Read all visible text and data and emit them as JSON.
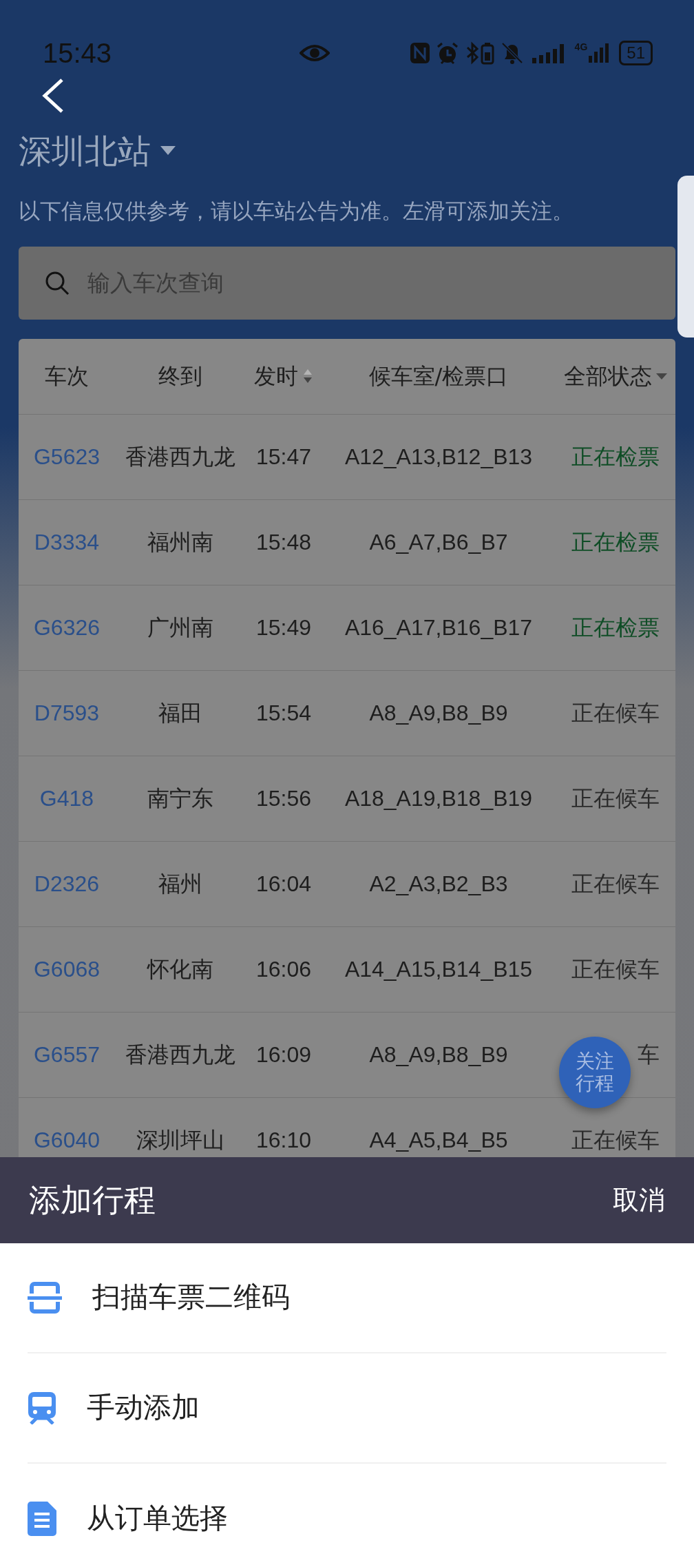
{
  "status_bar": {
    "time": "15:43",
    "network": "4G",
    "battery": "51"
  },
  "header": {
    "title": "深圳北站",
    "notice": "以下信息仅供参考，请以车站公告为准。左滑可添加关注。"
  },
  "search": {
    "placeholder": "输入车次查询"
  },
  "table": {
    "columns": [
      {
        "label": "车次"
      },
      {
        "label": "终到"
      },
      {
        "label": "发时",
        "sortable": true
      },
      {
        "label": "候车室/检票口"
      },
      {
        "label": "全部状态",
        "dropdown": true
      }
    ],
    "rows": [
      {
        "train": "G5623",
        "destination": "香港西九龙",
        "departs": "15:47",
        "gates": "A12_A13,B12_B13",
        "status": "正在检票",
        "color": "#0f4d26"
      },
      {
        "train": "D3334",
        "destination": "福州南",
        "departs": "15:48",
        "gates": "A6_A7,B6_B7",
        "status": "正在检票",
        "color": "#0f4d26"
      },
      {
        "train": "G6326",
        "destination": "广州南",
        "departs": "15:49",
        "gates": "A16_A17,B16_B17",
        "status": "正在检票",
        "color": "#0f4d26"
      },
      {
        "train": "D7593",
        "destination": "福田",
        "departs": "15:54",
        "gates": "A8_A9,B8_B9",
        "status": "正在候车",
        "color": "#2a2a2a"
      },
      {
        "train": "G418",
        "destination": "南宁东",
        "departs": "15:56",
        "gates": "A18_A19,B18_B19",
        "status": "正在候车",
        "color": "#2a2a2a"
      },
      {
        "train": "D2326",
        "destination": "福州",
        "departs": "16:04",
        "gates": "A2_A3,B2_B3",
        "status": "正在候车",
        "color": "#2a2a2a"
      },
      {
        "train": "G6068",
        "destination": "怀化南",
        "departs": "16:06",
        "gates": "A14_A15,B14_B15",
        "status": "正在候车",
        "color": "#2a2a2a"
      },
      {
        "train": "G6557",
        "destination": "香港西九龙",
        "departs": "16:09",
        "gates": "A8_A9,B8_B9",
        "status": "车",
        "color": "#2a2a2a"
      },
      {
        "train": "G6040",
        "destination": "深圳坪山",
        "departs": "16:10",
        "gates": "A4_A5,B4_B5",
        "status": "正在候车",
        "color": "#2a2a2a"
      }
    ]
  },
  "fab": {
    "label": "关注行程"
  },
  "sheet": {
    "title": "添加行程",
    "cancel": "取消",
    "options": [
      {
        "label": "扫描车票二维码",
        "kind": "scan"
      },
      {
        "label": "手动添加",
        "kind": "train"
      },
      {
        "label": "从订单选择",
        "kind": "order"
      }
    ]
  }
}
